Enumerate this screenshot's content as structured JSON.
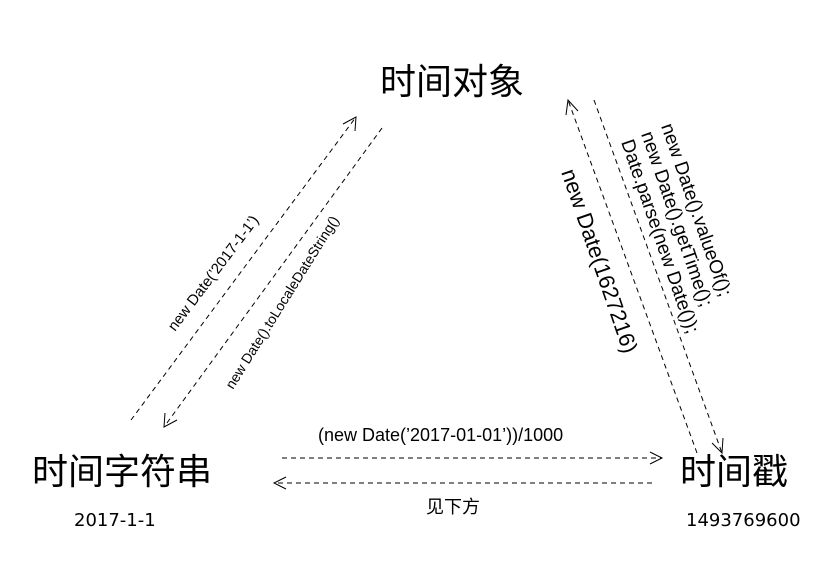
{
  "nodes": {
    "object": {
      "title": "时间对象"
    },
    "string": {
      "title": "时间字符串",
      "example": "2017-1-1"
    },
    "timestamp": {
      "title": "时间戳",
      "example": "1493769600"
    }
  },
  "edges": {
    "string_to_object": "new Date(’2017-1-1’)",
    "object_to_string": "new Date().toLocaleDateString()",
    "timestamp_to_object": "new Date(1627216)",
    "object_to_timestamp": [
      "new Date().valueOf();",
      "new Date().getTime();",
      "Date.parse(new Date());"
    ],
    "string_to_timestamp": "(new Date(’2017-01-01’))/1000",
    "timestamp_to_string": "见下方"
  }
}
